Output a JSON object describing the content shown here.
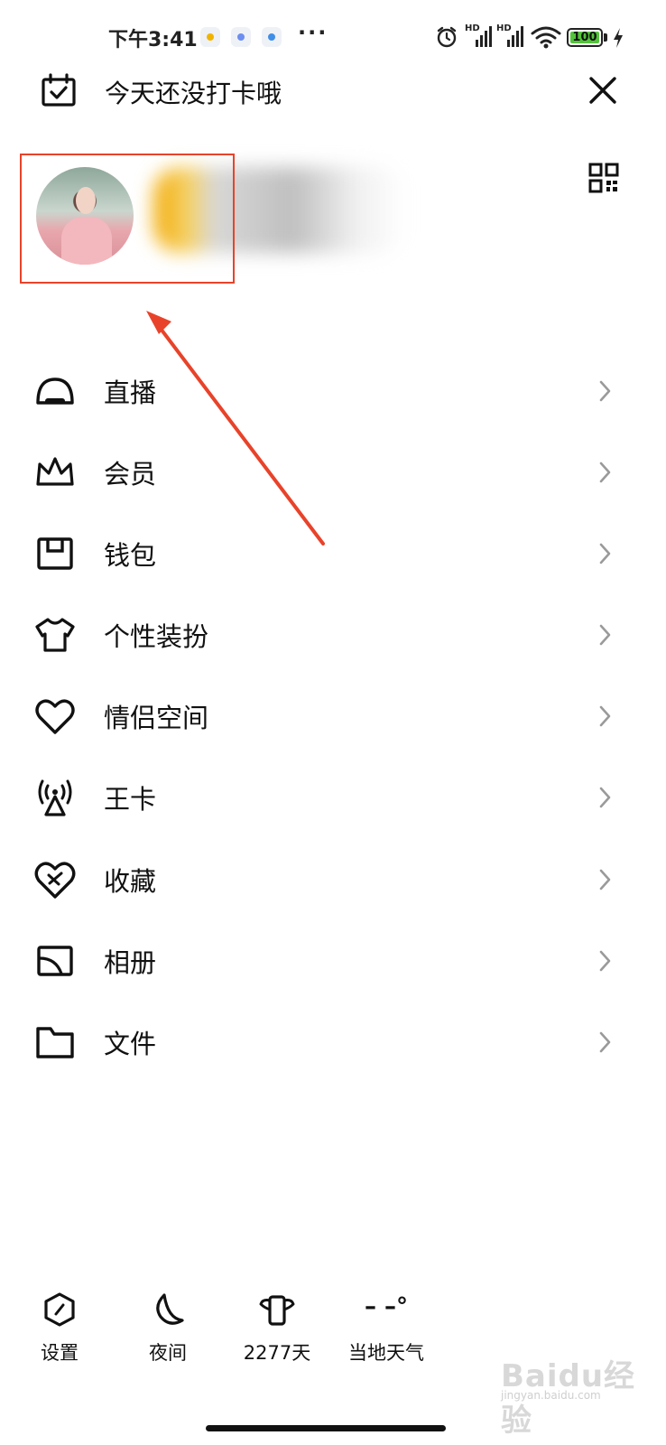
{
  "status_bar": {
    "time": "下午3:41",
    "overflow": "···",
    "signal_1_label": "HD",
    "signal_2_label": "HD",
    "battery_level": "100",
    "battery_fraction": 1.0,
    "battery_color": "#54c33c"
  },
  "header": {
    "checkin_text": "今天还没打卡哦",
    "calendar_icon": "calendar-check-icon",
    "close_icon": "close-icon"
  },
  "profile": {
    "qr_icon": "qr-code-icon",
    "highlight_color": "#e8432a"
  },
  "menu": {
    "items": [
      {
        "label": "直播",
        "icon": "live-icon"
      },
      {
        "label": "会员",
        "icon": "crown-icon"
      },
      {
        "label": "钱包",
        "icon": "wallet-icon"
      },
      {
        "label": "个性装扮",
        "icon": "tshirt-icon"
      },
      {
        "label": "情侣空间",
        "icon": "heart-icon"
      },
      {
        "label": "王卡",
        "icon": "signal-tower-icon"
      },
      {
        "label": "收藏",
        "icon": "favorite-icon"
      },
      {
        "label": "相册",
        "icon": "album-icon"
      },
      {
        "label": "文件",
        "icon": "folder-icon"
      }
    ]
  },
  "bottom_bar": {
    "settings_label": "设置",
    "night_label": "夜间",
    "days_label": "2277天",
    "weather_label": "当地天气",
    "weather_temp": "– –°"
  },
  "watermark": {
    "text": "Baidu经验",
    "url": "jingyan.baidu.com"
  }
}
